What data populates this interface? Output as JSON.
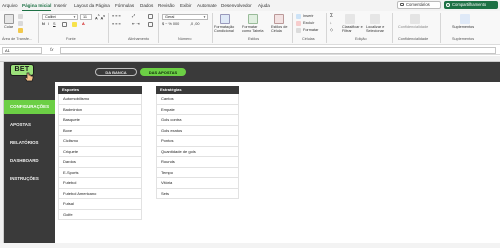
{
  "menu": {
    "tabs": [
      "Arquivo",
      "Página Inicial",
      "Inserir",
      "Layout da Página",
      "Fórmulas",
      "Dados",
      "Revisão",
      "Exibir",
      "Automate",
      "Desenvolvedor",
      "Ajuda"
    ],
    "comments_label": "Comentários",
    "share_label": "Compartilhamento"
  },
  "ribbon": {
    "paste_label": "Colar",
    "font_name": "Calibri",
    "font_size": "11",
    "number_format": "Geral",
    "clipboard_group": "Área de Transfe...",
    "font_group": "Fonte",
    "alignment_group": "Alinhamento",
    "number_group": "Número",
    "styles_group": "Estilos",
    "cells_group": "Células",
    "editing_group": "Edição",
    "confidentiality_group": "Confidencialidade",
    "addins_group": "Suplementos",
    "conditional_formatting": "Formatação Condicional",
    "format_as_table": "Formatar como Tabela",
    "cell_styles": "Estilos de Célula",
    "insert": "Inserir",
    "delete": "Excluir",
    "format": "Formatar",
    "sort_filter": "Classificar e Filtrar",
    "find_select": "Localizar e Selecionar",
    "confidentiality": "Confidencialidade",
    "addins": "Suplementos"
  },
  "formula_bar": {
    "name_box": "A1",
    "fx": "fx",
    "value": ""
  },
  "dashboard": {
    "logo": "BET",
    "sidebar": [
      "CONFIGURAÇÕES",
      "APOSTAS",
      "RELATÓRIOS",
      "DASHBOARD",
      "INSTRUÇÕES"
    ],
    "active_sidebar": "CONFIGURAÇÕES",
    "top_buttons": [
      "DA BANCA",
      "DAS APOSTAS"
    ],
    "active_top_button": "DAS APOSTAS",
    "sports_header": "Esportes",
    "sports": [
      "Automobilismo",
      "Badminton",
      "Basquete",
      "Boxe",
      "Ciclismo",
      "Criquete",
      "Dardos",
      "E-Sports",
      "Futebol",
      "Futebol Americano",
      "Futsal",
      "Golfe"
    ],
    "strategies_header": "Estratégias",
    "strategies": [
      "Cantos",
      "Empate",
      "Gols contra",
      "Gols exatos",
      "Pontos",
      "Quantidade de gols",
      "Rounds",
      "Tempo",
      "Vitória",
      "Sets"
    ]
  },
  "colors": {
    "accent_green": "#6ccf45",
    "dark": "#3a3a3a",
    "excel_green": "#1e7145"
  }
}
